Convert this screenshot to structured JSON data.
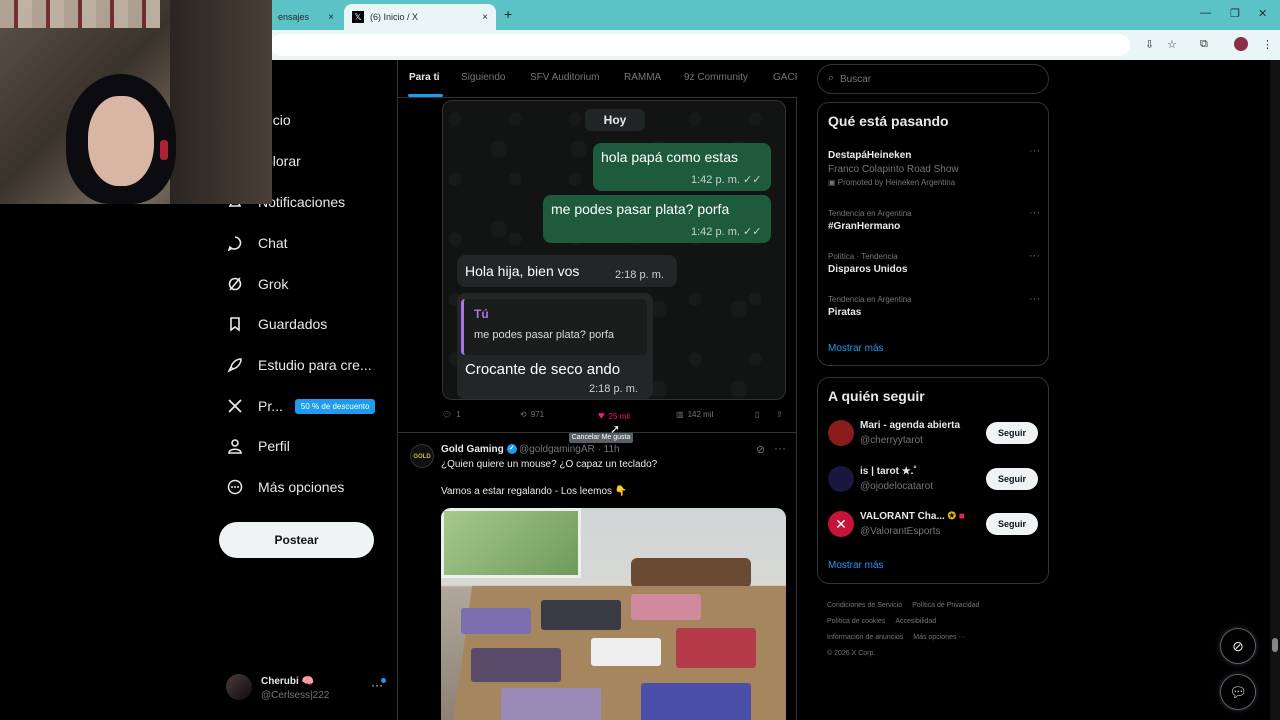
{
  "browser": {
    "tabs": [
      {
        "label": "ensajes",
        "active": false
      },
      {
        "label": "(6) Inicio / X",
        "active": true
      }
    ],
    "new_tab": "+",
    "close": "×",
    "window_controls": [
      "—",
      "❐",
      "✕"
    ]
  },
  "nav": {
    "items": [
      {
        "label": "Inicio",
        "icon": "home-icon"
      },
      {
        "label": "xplorar",
        "icon": "search-icon"
      },
      {
        "label": "Notificaciones",
        "icon": "bell-icon"
      },
      {
        "label": "Chat",
        "icon": "chat-icon"
      },
      {
        "label": "Grok",
        "icon": "grok-icon"
      },
      {
        "label": "Guardados",
        "icon": "bookmark-icon"
      },
      {
        "label": "Estudio para cre...",
        "icon": "rocket-icon"
      },
      {
        "label": "Pr...",
        "icon": "x-logo-icon",
        "badge": "50 % de descuento"
      },
      {
        "label": "Perfil",
        "icon": "person-icon"
      },
      {
        "label": "Más opciones",
        "icon": "more-circle-icon"
      }
    ],
    "post_button": "Postear",
    "account": {
      "name": "Cherubi 🧠",
      "handle": "@Cerlsess|222",
      "more": "···"
    }
  },
  "feed": {
    "tabs": [
      "Para ti",
      "Siguiendo",
      "SFV Auditorium",
      "RAMMA",
      "9z Community",
      "GACI"
    ],
    "active_tab": "Para ti",
    "post1": {
      "chat": {
        "day": "Hoy",
        "msg1": {
          "text": "hola papá como estas",
          "time": "1:42 p. m. ✓✓"
        },
        "msg2": {
          "text": "me podes pasar plata? porfa",
          "time": "1:42 p. m. ✓✓"
        },
        "msg3": {
          "text": "Hola hija, bien vos",
          "time": "2:18 p. m."
        },
        "reply": {
          "quote_author": "Tú",
          "quote_text": "me podes pasar plata? porfa",
          "text": "Crocante de seco ando",
          "time": "2:18 p. m."
        }
      },
      "actions": {
        "replies": "1",
        "reposts": "971",
        "likes": "25 mil",
        "views": "142 mil"
      },
      "tooltip": "Cancelar Me gusta"
    },
    "post2": {
      "author": "Gold Gaming",
      "avatar_text": "GOLD",
      "meta": "@goldgamingAR · 11h",
      "line1": "¿Quien quiere un mouse? ¿O capaz un teclado?",
      "line2": "Vamos a estar regalando - Los leemos 👇"
    }
  },
  "right": {
    "search_placeholder": "Buscar",
    "trends_title": "Qué está pasando",
    "trends": [
      {
        "category": "",
        "name": "DestapáHeineken",
        "sub": "Franco Colapinto Road Show",
        "promo": "Promoted by Heineken Argentina"
      },
      {
        "category": "Tendencia en Argentina",
        "name": "#GranHermano"
      },
      {
        "category": "Política · Tendencia",
        "name": "Disparos Unidos"
      },
      {
        "category": "Tendencia en Argentina",
        "name": "Piratas"
      }
    ],
    "show_more": "Mostrar más",
    "follow_title": "A quién seguir",
    "follow": [
      {
        "name": "Mari - agenda abierta",
        "handle": "@cherryytarot",
        "button": "Seguir",
        "color": "#8a1c1c"
      },
      {
        "name": "is | tarot ★.˚",
        "handle": "@ojodelocatarot",
        "button": "Seguir",
        "color": "#1a1640"
      },
      {
        "name": "VALORANT Cha...",
        "handle": "@ValorantEsports",
        "button": "Seguir",
        "color": "#c4143a"
      }
    ],
    "footer": [
      "Condiciones de Servicio",
      "Política de Privacidad",
      "Política de cookies",
      "Accesibilidad",
      "Información de anuncios",
      "Más opciones ···",
      "© 2026 X Corp."
    ]
  },
  "colors": {
    "accent": "#1d9bf0",
    "like": "#f91880",
    "bubble_out": "#1e5b3c"
  }
}
